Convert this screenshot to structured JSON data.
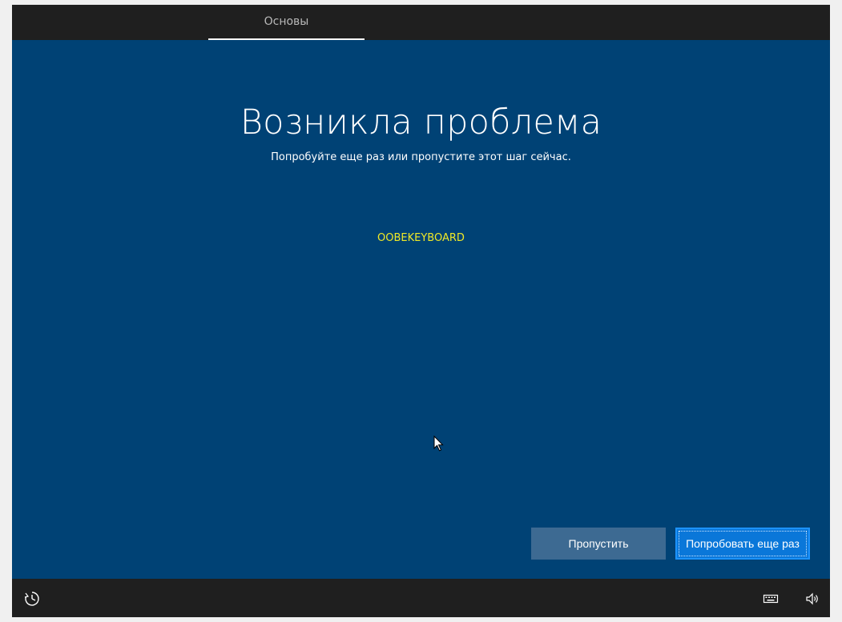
{
  "header": {
    "tab_label": "Основы"
  },
  "main": {
    "title": "Возникла проблема",
    "subtitle": "Попробуйте еще раз или пропустите этот шаг сейчас.",
    "error_code": "OOBEKEYBOARD"
  },
  "actions": {
    "skip_label": "Пропустить",
    "retry_label": "Попробовать еще раз"
  },
  "footer": {
    "icons": [
      "ease-of-access-icon",
      "keyboard-icon",
      "volume-icon"
    ]
  },
  "colors": {
    "background": "#004275",
    "bars": "#1f1f1f",
    "accent": "#0a77d9",
    "error_code": "#f0e926"
  }
}
